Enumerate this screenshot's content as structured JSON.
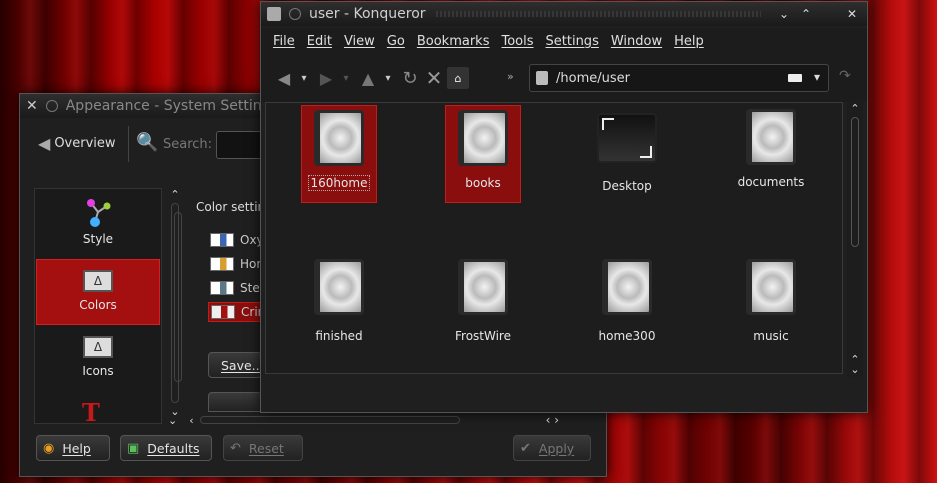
{
  "appearance": {
    "title": "Appearance - System Settings",
    "overview_label": "Overview",
    "search_label": "Search:",
    "color_settings_label": "Color settin",
    "sidebar": [
      {
        "label": "Style",
        "icon": "style-icon",
        "selected": false
      },
      {
        "label": "Colors",
        "icon": "colors-icon",
        "selected": true
      },
      {
        "label": "Icons",
        "icon": "icons-icon",
        "selected": false
      }
    ],
    "schemes": [
      {
        "label": "Oxy",
        "selected": false
      },
      {
        "label": "Hor",
        "selected": false
      },
      {
        "label": "Ste",
        "selected": false
      },
      {
        "label": "Crir",
        "selected": true
      }
    ],
    "save_label": "Save...",
    "help_label": "Help",
    "defaults_label": "Defaults",
    "reset_label": "Reset",
    "apply_label": "Apply"
  },
  "konqueror": {
    "title": "user - Konqueror",
    "menus": [
      "File",
      "Edit",
      "View",
      "Go",
      "Bookmarks",
      "Tools",
      "Settings",
      "Window",
      "Help"
    ],
    "location": "/home/user",
    "files": [
      {
        "name": "160home",
        "type": "folder",
        "selected": true
      },
      {
        "name": "books",
        "type": "folder",
        "selected": true
      },
      {
        "name": "Desktop",
        "type": "desktop",
        "selected": false
      },
      {
        "name": "documents",
        "type": "folder",
        "selected": false
      },
      {
        "name": "finished",
        "type": "folder",
        "selected": false
      },
      {
        "name": "FrostWire",
        "type": "folder",
        "selected": false
      },
      {
        "name": "home300",
        "type": "folder",
        "selected": false
      },
      {
        "name": "music",
        "type": "folder",
        "selected": false
      }
    ]
  }
}
